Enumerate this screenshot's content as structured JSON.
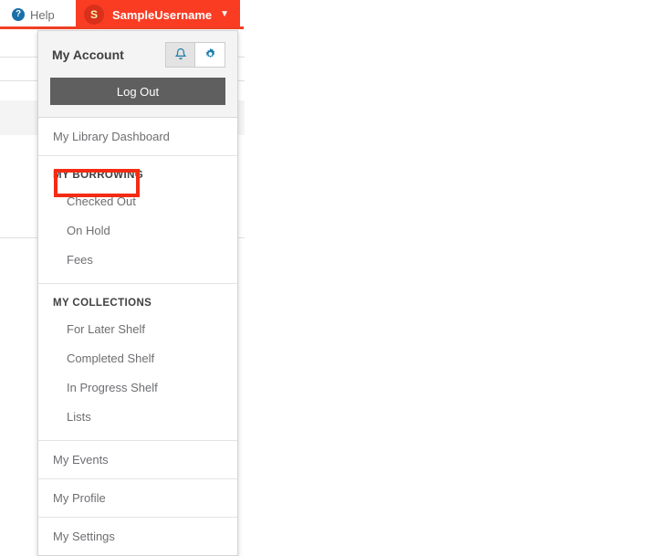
{
  "topbar": {
    "help": {
      "icon": "help-circle-icon",
      "glyph": "?",
      "label": "Help"
    },
    "user": {
      "avatar_initial": "S",
      "username": "SampleUsername",
      "chevron": "▼"
    }
  },
  "dropdown": {
    "header": {
      "title": "My Account",
      "alerts_icon": "bell-icon",
      "settings_icon": "gear-icon"
    },
    "logout_label": "Log Out",
    "dashboard_label": "My Library Dashboard",
    "borrowing": {
      "section_label": "MY BORROWING",
      "items": [
        {
          "label": "Checked Out",
          "highlighted": true
        },
        {
          "label": "On Hold",
          "highlighted": false
        },
        {
          "label": "Fees",
          "highlighted": false
        }
      ]
    },
    "collections": {
      "section_label": "MY COLLECTIONS",
      "items": [
        {
          "label": "For Later Shelf"
        },
        {
          "label": "Completed Shelf"
        },
        {
          "label": "In Progress Shelf"
        },
        {
          "label": "Lists"
        }
      ]
    },
    "footer_items": [
      {
        "label": "My Events"
      },
      {
        "label": "My Profile"
      },
      {
        "label": "My Settings"
      }
    ]
  },
  "colors": {
    "brand_red": "#fa3c23",
    "avatar_red": "#d8301a",
    "highlight_red": "#f42b13",
    "logout_grey": "#5f5f5f",
    "help_blue": "#1a6fa8",
    "icon_blue": "#1a7ba8"
  }
}
